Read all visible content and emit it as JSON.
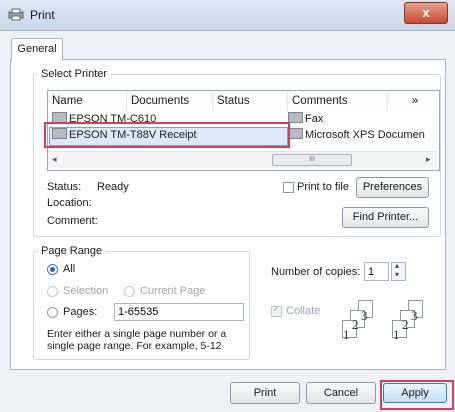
{
  "window": {
    "title": "Print",
    "close": "x"
  },
  "tabs": [
    "General"
  ],
  "select_printer": {
    "legend": "Select Printer",
    "columns": [
      "Name",
      "Documents",
      "Status",
      "Comments",
      "»"
    ],
    "printers": [
      {
        "name": "EPSON TM-C610",
        "selected": false
      },
      {
        "name": "EPSON TM-T88V Receipt",
        "selected": true
      }
    ],
    "right_printers": [
      "Fax",
      "Microsoft XPS Documen"
    ],
    "scroll_thumb": "III",
    "status_label": "Status:",
    "status_value": "Ready",
    "location_label": "Location:",
    "comment_label": "Comment:",
    "print_to_file": "Print to file",
    "preferences": "Preferences",
    "find_printer": "Find Printer..."
  },
  "page_range": {
    "legend": "Page Range",
    "all": "All",
    "selection": "Selection",
    "current_page": "Current Page",
    "pages": "Pages:",
    "pages_value": "1-65535",
    "hint": "Enter either a single page number or a single page range.  For example, 5-12"
  },
  "copies": {
    "label": "Number of copies:",
    "value": "1",
    "collate": "Collate",
    "collate_numbers": [
      "1",
      "2",
      "3"
    ]
  },
  "buttons": {
    "print": "Print",
    "cancel": "Cancel",
    "apply": "Apply"
  },
  "colors": {
    "highlight": "#e03a4c",
    "selection": "#dce9f8"
  }
}
